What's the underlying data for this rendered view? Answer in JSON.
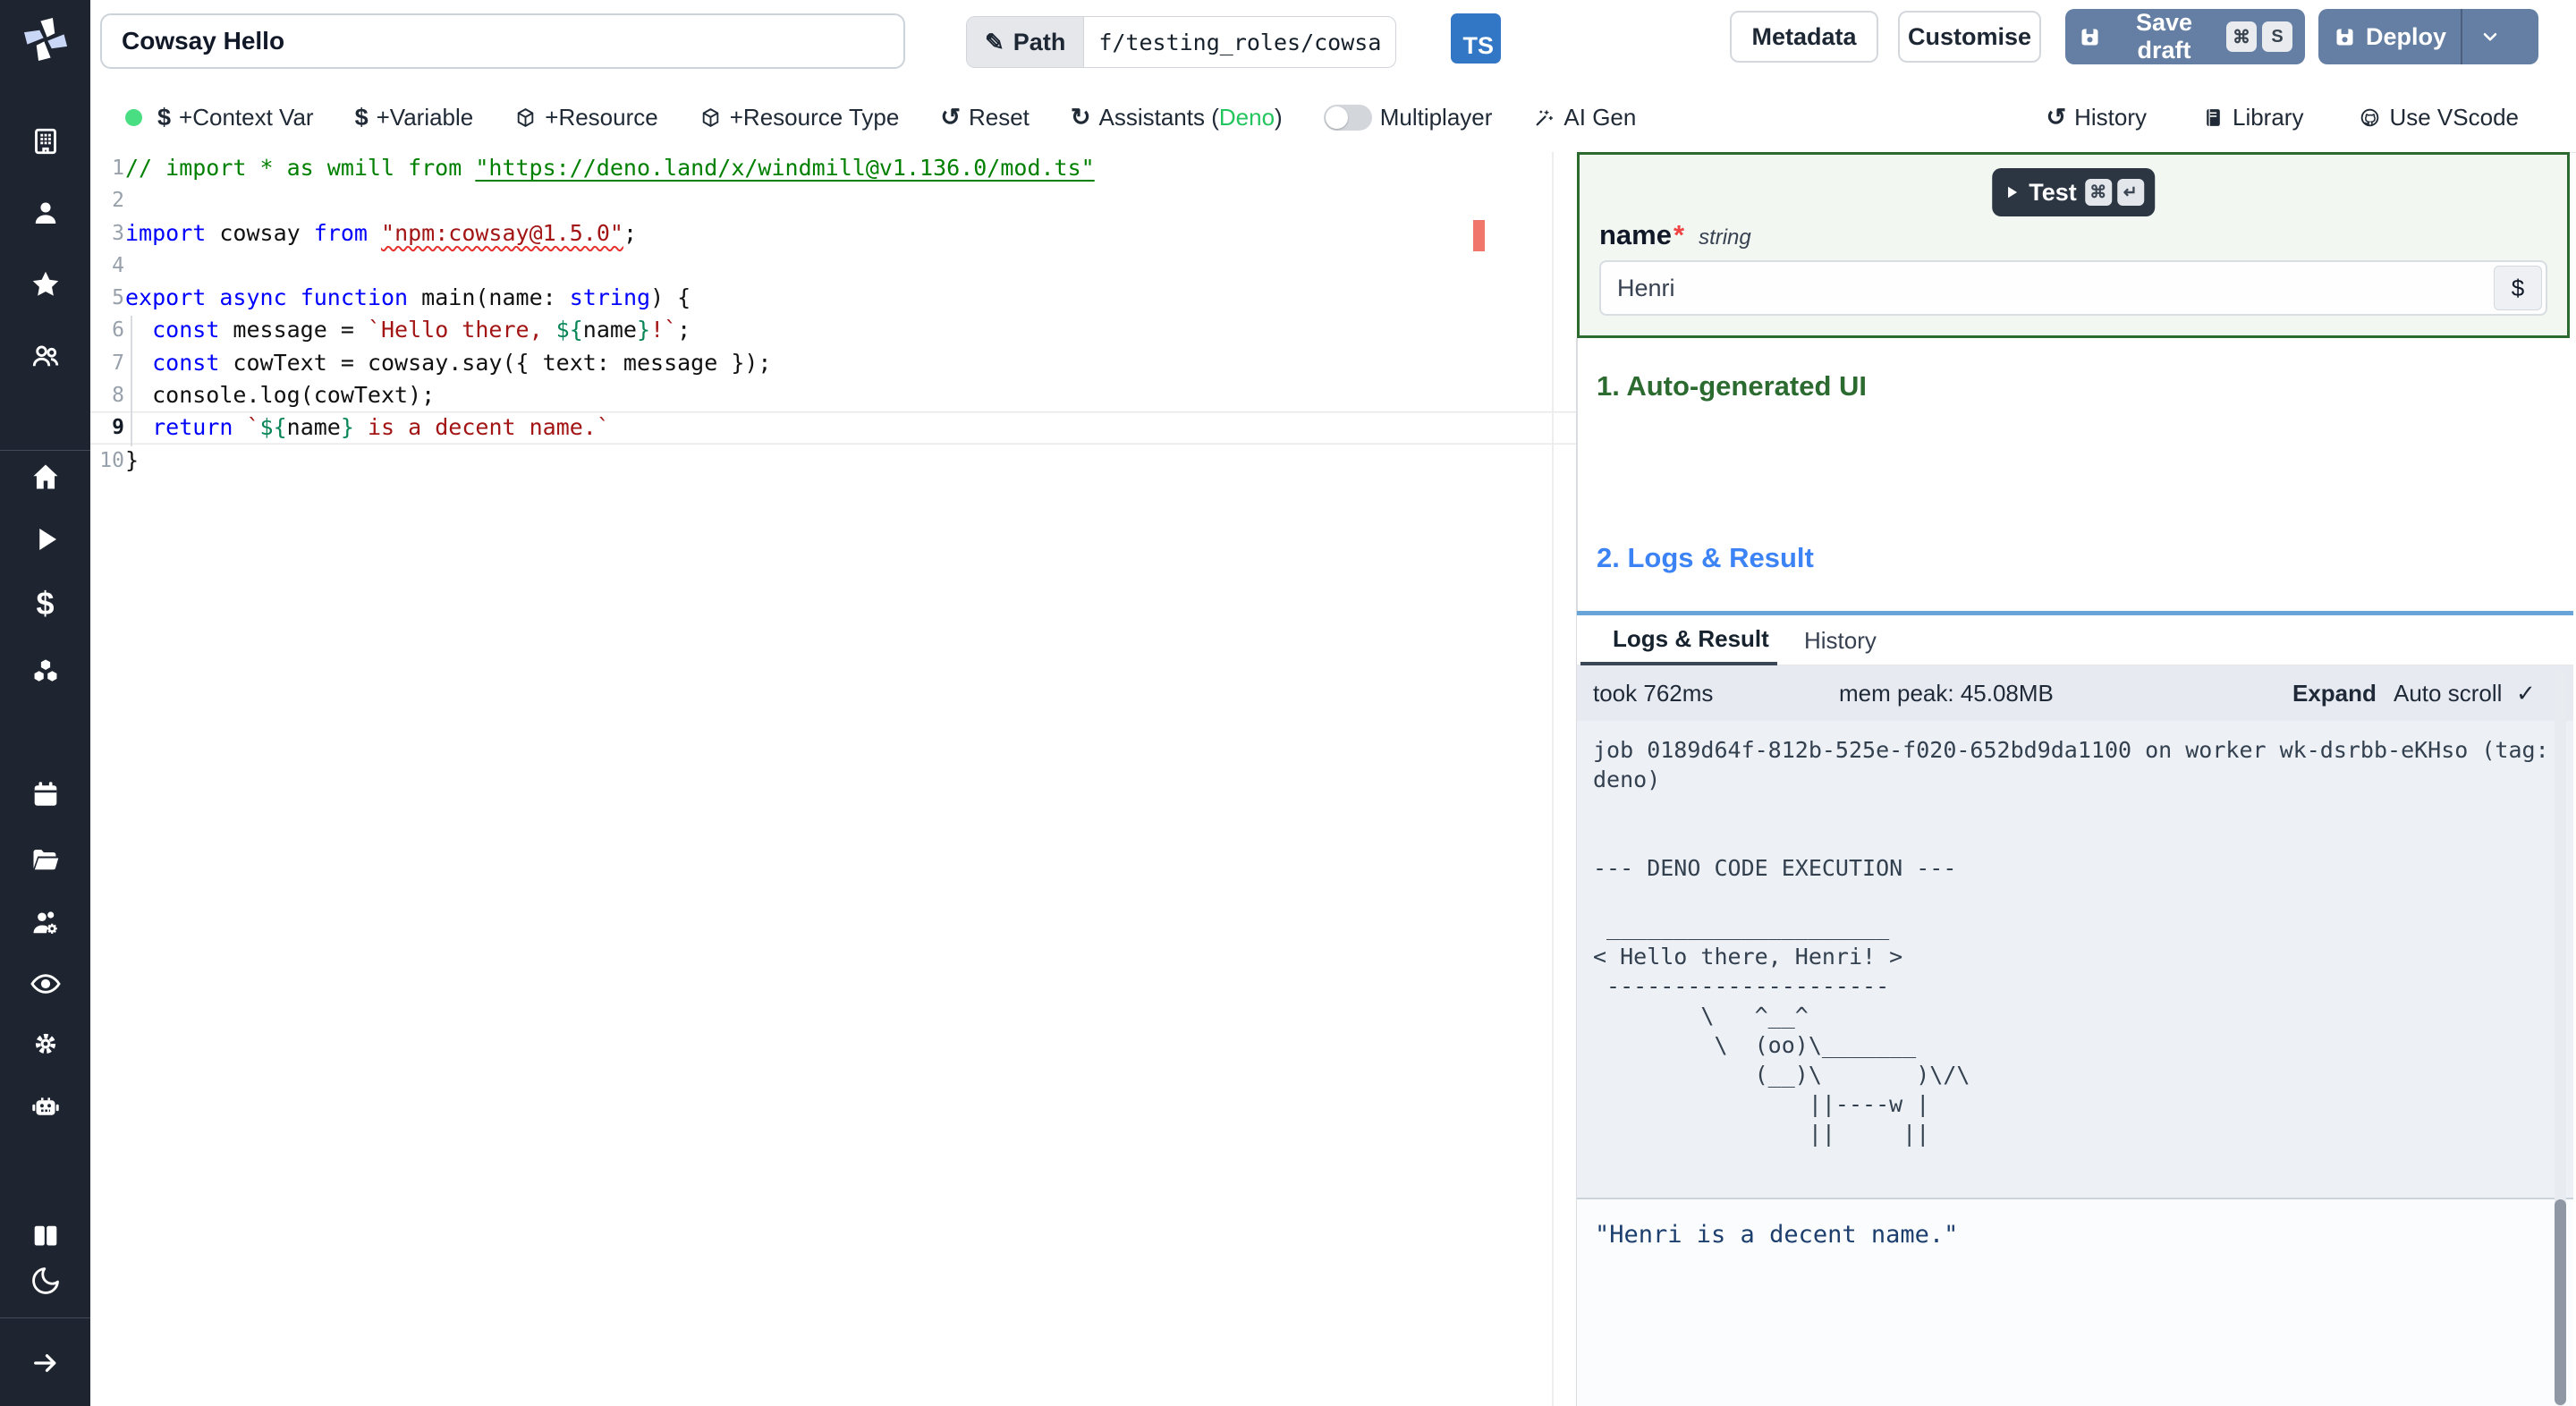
{
  "topbar": {
    "title_value": "Cowsay Hello",
    "path_label": "Path",
    "path_value": "f/testing_roles/cowsa",
    "lang_badge": "TS",
    "metadata_label": "Metadata",
    "customise_label": "Customise",
    "save_draft_label": "Save draft",
    "save_draft_keys": [
      "⌘",
      "S"
    ],
    "deploy_label": "Deploy"
  },
  "toolbar": {
    "items_left": [
      {
        "name": "add-context-var-button",
        "icon": "dollar-icon",
        "label": "+Context Var"
      },
      {
        "name": "add-variable-button",
        "icon": "dollar-icon",
        "label": "+Variable"
      },
      {
        "name": "add-resource-button",
        "icon": "cube-icon",
        "label": "+Resource"
      },
      {
        "name": "add-resource-type-button",
        "icon": "cube-icon",
        "label": "+Resource Type"
      },
      {
        "name": "reset-button",
        "icon": "reset-icon",
        "label": "Reset"
      },
      {
        "name": "assistants-button",
        "icon": "refresh-icon",
        "label_prefix": "Assistants (",
        "label_colored": "Deno",
        "label_suffix": ")"
      }
    ],
    "multiplayer": {
      "name": "multiplayer-toggle",
      "label": "Multiplayer",
      "enabled": false
    },
    "ai_gen": {
      "name": "ai-gen-button",
      "icon": "wand-icon",
      "label": "AI Gen"
    },
    "items_right": [
      {
        "name": "history-button",
        "icon": "history-icon",
        "label": "History"
      },
      {
        "name": "library-button",
        "icon": "library-icon",
        "label": "Library"
      },
      {
        "name": "use-vscode-button",
        "icon": "github-icon",
        "label": "Use VScode"
      }
    ]
  },
  "sidebar": {
    "icons": [
      {
        "name": "workspace-building-icon"
      },
      {
        "name": "user-icon"
      },
      {
        "name": "favorites-star-icon"
      },
      {
        "name": "groups-icon"
      },
      {
        "name": "home-icon"
      },
      {
        "name": "runs-play-icon"
      },
      {
        "name": "variables-dollar-icon"
      },
      {
        "name": "resources-cubes-icon"
      },
      {
        "name": "schedules-calendar-icon"
      },
      {
        "name": "folders-icon"
      },
      {
        "name": "groups-admin-icon"
      },
      {
        "name": "audit-logs-eye-icon"
      },
      {
        "name": "settings-gear-icon"
      },
      {
        "name": "workers-robot-icon"
      },
      {
        "name": "docs-book-icon"
      },
      {
        "name": "dark-mode-moon-icon"
      },
      {
        "name": "collapse-arrow-icon"
      }
    ]
  },
  "editor": {
    "lines": [
      {
        "n": 1,
        "tokens": [
          {
            "t": "// import * as wmill from ",
            "c": "comment"
          },
          {
            "t": "\"https://deno.land/x/windmill@v1.136.0/mod.ts\"",
            "c": "comment-link"
          }
        ]
      },
      {
        "n": 2,
        "tokens": []
      },
      {
        "n": 3,
        "tokens": [
          {
            "t": "import",
            "c": "kw"
          },
          {
            "t": " cowsay ",
            "c": "plain"
          },
          {
            "t": "from",
            "c": "kw"
          },
          {
            "t": " ",
            "c": "plain"
          },
          {
            "t": "\"npm:cowsay@1.5.0\"",
            "c": "str squiggle"
          },
          {
            "t": ";",
            "c": "plain"
          }
        ]
      },
      {
        "n": 4,
        "tokens": []
      },
      {
        "n": 5,
        "tokens": [
          {
            "t": "export",
            "c": "kw"
          },
          {
            "t": " ",
            "c": "plain"
          },
          {
            "t": "async",
            "c": "kw"
          },
          {
            "t": " ",
            "c": "plain"
          },
          {
            "t": "function",
            "c": "kw"
          },
          {
            "t": " main(name: ",
            "c": "plain"
          },
          {
            "t": "string",
            "c": "type"
          },
          {
            "t": ") {",
            "c": "plain"
          }
        ]
      },
      {
        "n": 6,
        "tokens": [
          {
            "t": "  ",
            "c": "plain"
          },
          {
            "t": "const",
            "c": "kw"
          },
          {
            "t": " message = ",
            "c": "plain"
          },
          {
            "t": "`Hello there, ",
            "c": "str"
          },
          {
            "t": "${",
            "c": "interp"
          },
          {
            "t": "name",
            "c": "plain"
          },
          {
            "t": "}",
            "c": "interp"
          },
          {
            "t": "!`",
            "c": "str"
          },
          {
            "t": ";",
            "c": "plain"
          }
        ]
      },
      {
        "n": 7,
        "tokens": [
          {
            "t": "  ",
            "c": "plain"
          },
          {
            "t": "const",
            "c": "kw"
          },
          {
            "t": " cowText = cowsay.say({ text: message });",
            "c": "plain"
          }
        ]
      },
      {
        "n": 8,
        "tokens": [
          {
            "t": "  console.log(cowText);",
            "c": "plain"
          }
        ]
      },
      {
        "n": 9,
        "current": true,
        "tokens": [
          {
            "t": "  ",
            "c": "plain"
          },
          {
            "t": "return",
            "c": "kw"
          },
          {
            "t": " ",
            "c": "plain"
          },
          {
            "t": "`",
            "c": "str"
          },
          {
            "t": "${",
            "c": "interp"
          },
          {
            "t": "name",
            "c": "plain"
          },
          {
            "t": "}",
            "c": "interp"
          },
          {
            "t": " is a decent name.`",
            "c": "str"
          }
        ]
      },
      {
        "n": 10,
        "tokens": [
          {
            "t": "}",
            "c": "plain"
          }
        ]
      }
    ]
  },
  "form": {
    "test_label": "Test",
    "test_keys": [
      "⌘",
      "↵"
    ],
    "field_name": "name",
    "required_mark": "*",
    "field_type": "string",
    "field_value": "Henri",
    "insert_var_label": "$"
  },
  "sections": {
    "ui_heading": "1. Auto-generated UI",
    "logs_heading": "2. Logs & Result"
  },
  "logs_panel": {
    "tabs": [
      {
        "label": "Logs & Result",
        "active": true
      },
      {
        "label": "History",
        "active": false
      }
    ],
    "took": "took 762ms",
    "mem": "mem peak: 45.08MB",
    "expand_label": "Expand",
    "autoscroll_label": "Auto scroll",
    "autoscroll_check": "✓",
    "log_lines": [
      "job 0189d64f-812b-525e-f020-652bd9da1100 on worker wk-dsrbb-eKHso (tag:",
      "deno)",
      "",
      "",
      "--- DENO CODE EXECUTION ---",
      "",
      " _____________________",
      "< Hello there, Henri! >",
      " ---------------------",
      "        \\   ^__^",
      "         \\  (oo)\\_______",
      "            (__)\\       )\\/\\",
      "                ||----w |",
      "                ||     ||"
    ],
    "result_value": "\"Henri is a decent name.\""
  },
  "colors": {
    "accent_blue": "#3c83f6",
    "accent_green": "#2c6b30",
    "button_blue": "#647fa3",
    "deno_green": "#22c55e",
    "status_green": "#4ade83",
    "ts_blue": "#3277c5",
    "error_red": "#f0766b"
  }
}
